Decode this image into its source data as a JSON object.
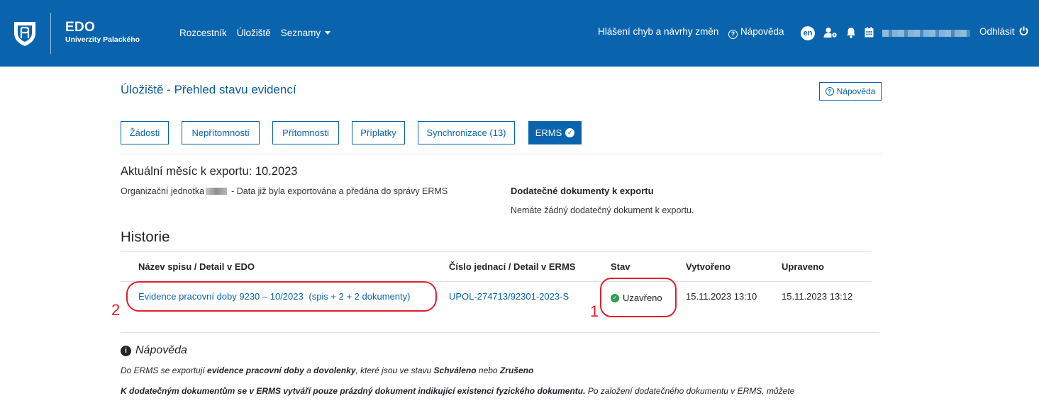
{
  "header": {
    "brand_title": "EDO",
    "brand_subtitle": "Univerzity Palackého",
    "nav": [
      "Rozcestník",
      "Úložiště",
      "Seznamy"
    ],
    "report_link": "Hlášení chyb a návrhy změn",
    "help_link": "Nápověda",
    "language": "en",
    "logout": "Odhlásit",
    "icons": [
      "user-settings-icon",
      "bell-icon",
      "calendar-icon",
      "power-icon"
    ]
  },
  "page": {
    "title": "Úložiště - Přehled stavu evidencí",
    "help_button": "Nápověda"
  },
  "tabs": [
    {
      "label": "Žádosti",
      "active": false
    },
    {
      "label": "Nepřítomnosti",
      "active": false
    },
    {
      "label": "Přítomnosti",
      "active": false
    },
    {
      "label": "Příplatky",
      "active": false
    },
    {
      "label": "Synchronizace (13)",
      "active": false
    },
    {
      "label": "ERMS",
      "active": true
    }
  ],
  "export": {
    "title": "Aktuální měsíc k exportu: 10.2023",
    "org_label": "Organizační jednotka",
    "org_status": "- Data již byla exportována a předána do správy ERMS",
    "extra_docs_title": "Dodatečné dokumenty k exportu",
    "extra_docs_empty": "Nemáte žádný dodatečný dokument k exportu."
  },
  "history": {
    "title": "Historie",
    "columns": [
      "Název spisu / Detail v EDO",
      "Číslo jednací / Detail v ERMS",
      "Stav",
      "Vytvořeno",
      "Upraveno"
    ],
    "rows": [
      {
        "name": "Evidence pracovní doby 9230 – 10/2023",
        "name_suffix": "(spis + 2 + 2 dokumenty)",
        "reference": "UPOL-274713/92301-2023-S",
        "status": "Uzavřeno",
        "created": "15.11.2023 13:10",
        "updated": "15.11.2023 13:12"
      }
    ]
  },
  "annotations": {
    "marker_1": "1",
    "marker_2": "2"
  },
  "help": {
    "title": "Nápověda",
    "line1": {
      "p1": "Do ERMS se exportují ",
      "b1": "evidence pracovní doby",
      "p2": " a ",
      "b2": "dovolenky",
      "p3": ", které jsou ve stavu ",
      "b3": "Schváleno",
      "p4": " nebo ",
      "b4": "Zrušeno"
    },
    "line2": {
      "b1": "K dodatečným dokumentům se v ERMS vytváří pouze prázdný dokument indikující existenci fyzického dokumentu.",
      "p1": " Po založení dodatečného dokumentu v ERMS, můžete"
    }
  },
  "colors": {
    "brand": "#0a64ad",
    "status_ok": "#2e9e4f",
    "annotation": "#e0202a"
  }
}
